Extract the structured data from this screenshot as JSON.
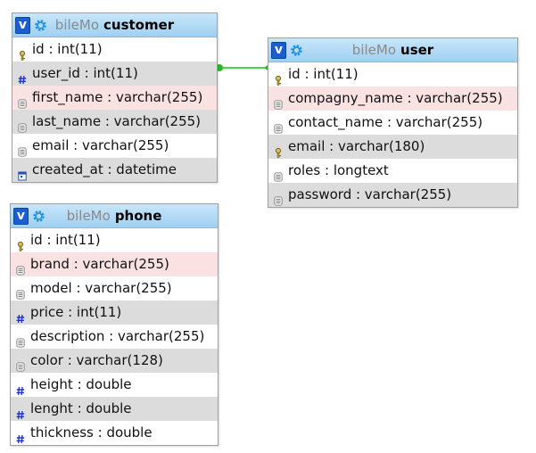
{
  "database": "bileMo",
  "tables": {
    "customer": {
      "name": "customer",
      "columns": [
        {
          "label": "id : int(11)",
          "icon": "key-icon",
          "shade": "white"
        },
        {
          "label": "user_id : int(11)",
          "icon": "hash-icon",
          "shade": "gray"
        },
        {
          "label": "first_name : varchar(255)",
          "icon": "text-icon",
          "shade": "pink"
        },
        {
          "label": "last_name : varchar(255)",
          "icon": "text-icon",
          "shade": "gray"
        },
        {
          "label": "email : varchar(255)",
          "icon": "text-icon",
          "shade": "white"
        },
        {
          "label": "created_at : datetime",
          "icon": "calendar-icon",
          "shade": "gray"
        }
      ]
    },
    "user": {
      "name": "user",
      "columns": [
        {
          "label": "id : int(11)",
          "icon": "key-icon",
          "shade": "white"
        },
        {
          "label": "compagny_name : varchar(255)",
          "icon": "text-icon",
          "shade": "pink"
        },
        {
          "label": "contact_name : varchar(255)",
          "icon": "text-icon",
          "shade": "white"
        },
        {
          "label": "email : varchar(180)",
          "icon": "key-icon",
          "shade": "gray"
        },
        {
          "label": "roles : longtext",
          "icon": "text-icon",
          "shade": "white"
        },
        {
          "label": "password : varchar(255)",
          "icon": "text-icon",
          "shade": "gray"
        }
      ]
    },
    "phone": {
      "name": "phone",
      "columns": [
        {
          "label": "id : int(11)",
          "icon": "key-icon",
          "shade": "white"
        },
        {
          "label": "brand : varchar(255)",
          "icon": "text-icon",
          "shade": "pink"
        },
        {
          "label": "model : varchar(255)",
          "icon": "text-icon",
          "shade": "white"
        },
        {
          "label": "price : int(11)",
          "icon": "hash-icon",
          "shade": "gray"
        },
        {
          "label": "description : varchar(255)",
          "icon": "text-icon",
          "shade": "white"
        },
        {
          "label": "color : varchar(128)",
          "icon": "text-icon",
          "shade": "gray"
        },
        {
          "label": "height : double",
          "icon": "hash-icon",
          "shade": "white"
        },
        {
          "label": "lenght : double",
          "icon": "hash-icon",
          "shade": "gray"
        },
        {
          "label": "thickness : double",
          "icon": "hash-icon",
          "shade": "white"
        }
      ]
    }
  },
  "relations": [
    {
      "from": "customer.user_id",
      "to": "user.id",
      "color": "#4cd44c"
    }
  ],
  "colors": {
    "header": "#9fd0f2",
    "v_button": "#1a5fd0",
    "gear": "#1e90e0",
    "row_gray": "#dcdcdc",
    "row_pink": "#fbe2e2"
  }
}
